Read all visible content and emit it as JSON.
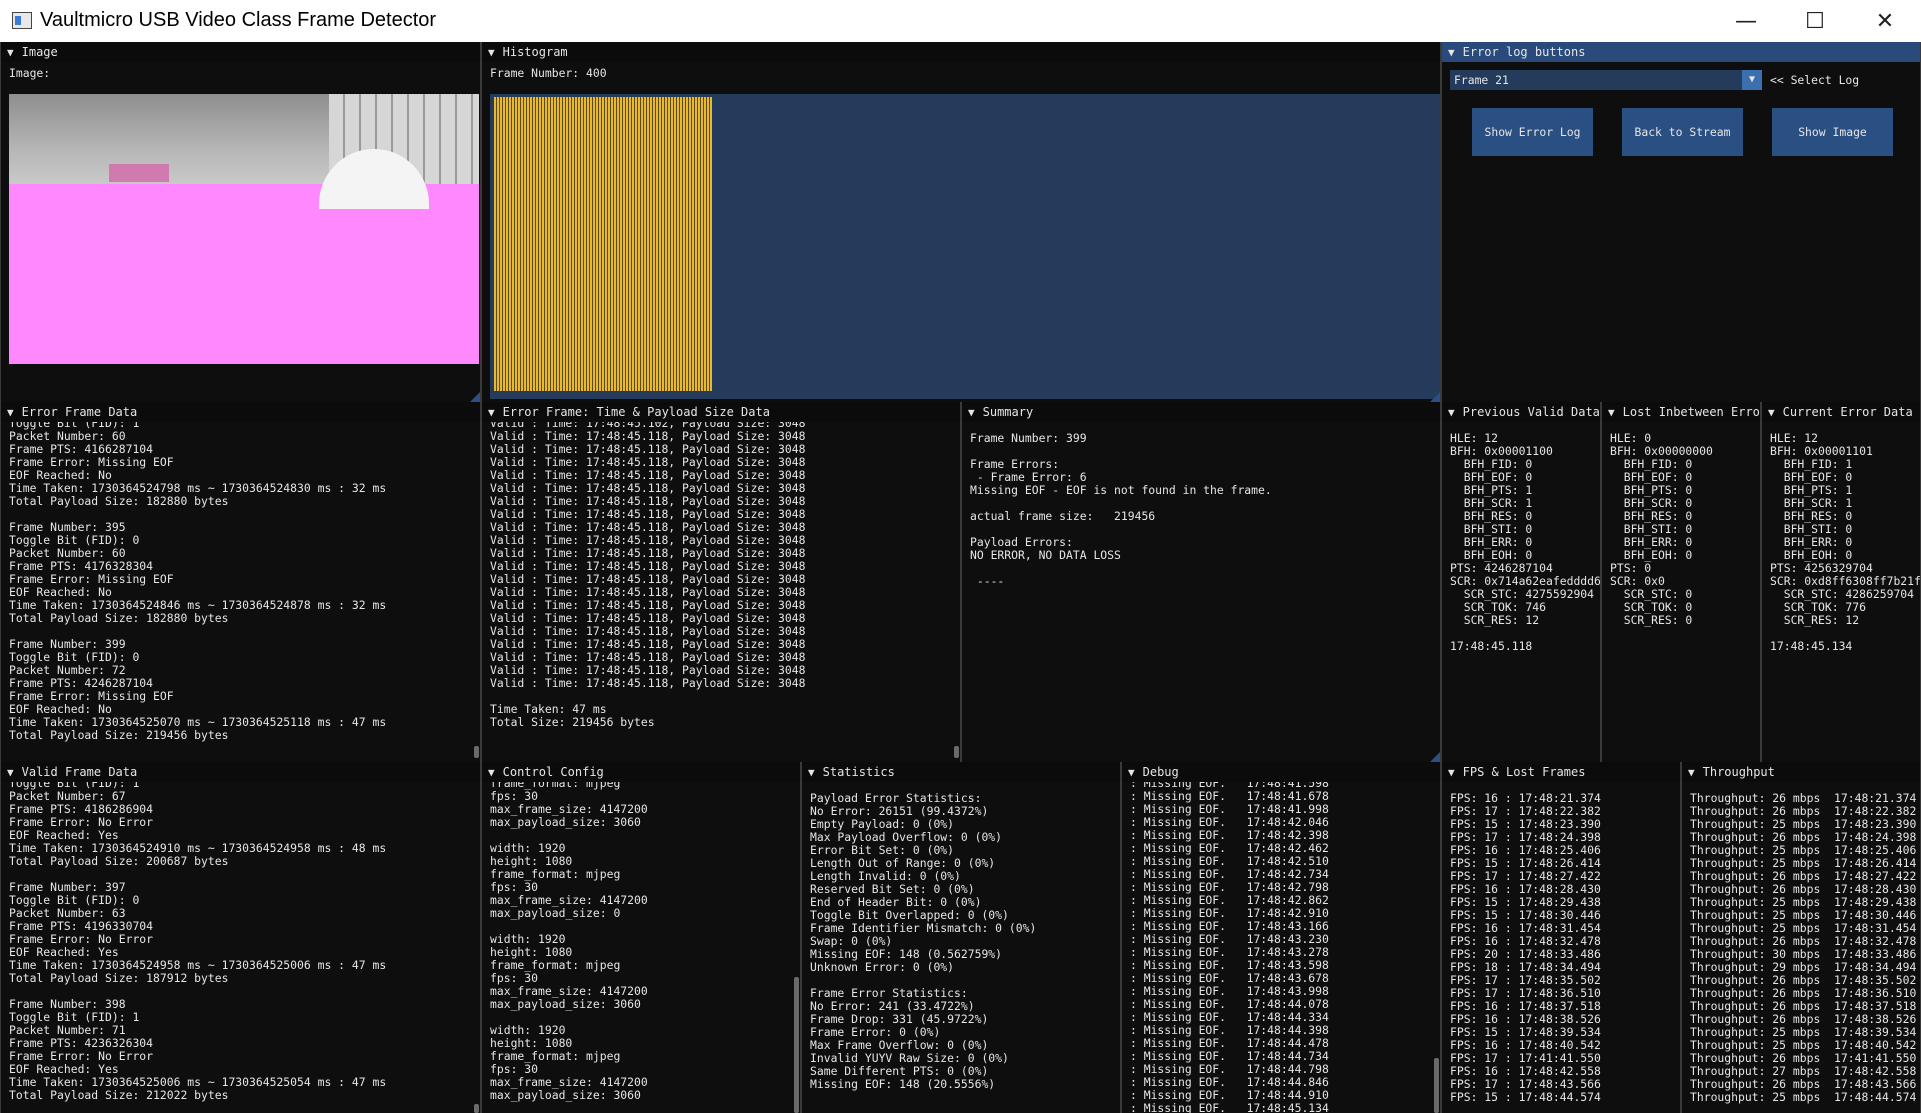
{
  "window": {
    "title": "Vaultmicro USB Video Class Frame Detector",
    "minimize": "—",
    "maximize": "☐",
    "close": "✕"
  },
  "image_panel": {
    "title": "Image",
    "label": "Image:"
  },
  "histogram": {
    "title": "Histogram",
    "frame_number": "Frame Number: 400"
  },
  "error_log": {
    "title": "Error log buttons",
    "selected": "Frame 21",
    "select_label": "<< Select Log",
    "buttons": [
      "Show Error Log",
      "Back to Stream",
      "Show Image"
    ]
  },
  "error_frame_data": {
    "title": "Error Frame Data",
    "text": "Toggle Bit (FID): 1\nPacket Number: 60\nFrame PTS: 4166287104\nFrame Error: Missing EOF\nEOF Reached: No\nTime Taken: 1730364524798 ms ~ 1730364524830 ms : 32 ms\nTotal Payload Size: 182880 bytes\n\nFrame Number: 395\nToggle Bit (FID): 0\nPacket Number: 60\nFrame PTS: 4176328304\nFrame Error: Missing EOF\nEOF Reached: No\nTime Taken: 1730364524846 ms ~ 1730364524878 ms : 32 ms\nTotal Payload Size: 182880 bytes\n\nFrame Number: 399\nToggle Bit (FID): 0\nPacket Number: 72\nFrame PTS: 4246287104\nFrame Error: Missing EOF\nEOF Reached: No\nTime Taken: 1730364525070 ms ~ 1730364525118 ms : 47 ms\nTotal Payload Size: 219456 bytes"
  },
  "error_time_payload": {
    "title": "Error Frame: Time & Payload Size Data",
    "text": "Valid : Time: 17:48:45.102, Payload Size: 3048\nValid : Time: 17:48:45.118, Payload Size: 3048\nValid : Time: 17:48:45.118, Payload Size: 3048\nValid : Time: 17:48:45.118, Payload Size: 3048\nValid : Time: 17:48:45.118, Payload Size: 3048\nValid : Time: 17:48:45.118, Payload Size: 3048\nValid : Time: 17:48:45.118, Payload Size: 3048\nValid : Time: 17:48:45.118, Payload Size: 3048\nValid : Time: 17:48:45.118, Payload Size: 3048\nValid : Time: 17:48:45.118, Payload Size: 3048\nValid : Time: 17:48:45.118, Payload Size: 3048\nValid : Time: 17:48:45.118, Payload Size: 3048\nValid : Time: 17:48:45.118, Payload Size: 3048\nValid : Time: 17:48:45.118, Payload Size: 3048\nValid : Time: 17:48:45.118, Payload Size: 3048\nValid : Time: 17:48:45.118, Payload Size: 3048\nValid : Time: 17:48:45.118, Payload Size: 3048\nValid : Time: 17:48:45.118, Payload Size: 3048\nValid : Time: 17:48:45.118, Payload Size: 3048\nValid : Time: 17:48:45.118, Payload Size: 3048\nValid : Time: 17:48:45.118, Payload Size: 3048\n\nTime Taken: 47 ms\nTotal Size: 219456 bytes"
  },
  "summary": {
    "title": "Summary",
    "text": "Frame Number: 399\n\nFrame Errors:\n - Frame Error: 6\nMissing EOF - EOF is not found in the frame.\n\nactual frame size:   219456\n\nPayload Errors:\nNO ERROR, NO DATA LOSS\n\n ----"
  },
  "previous_valid": {
    "title": "Previous Valid Data",
    "text": "HLE: 12\nBFH: 0x00001100\n  BFH_FID: 0\n  BFH_EOF: 0\n  BFH_PTS: 1\n  BFH_SCR: 1\n  BFH_RES: 0\n  BFH_STI: 0\n  BFH_ERR: 0\n  BFH_EOH: 0\nPTS: 4246287104\nSCR: 0x714a62eafedddd6\n  SCR_STC: 4275592904\n  SCR_TOK: 746\n  SCR_RES: 12\n\n17:48:45.118"
  },
  "lost_between": {
    "title": "Lost Inbetween Erro",
    "text": "HLE: 0\nBFH: 0x00000000\n  BFH_FID: 0\n  BFH_EOF: 0\n  BFH_PTS: 0\n  BFH_SCR: 0\n  BFH_RES: 0\n  BFH_STI: 0\n  BFH_ERR: 0\n  BFH_EOH: 0\nPTS: 0\nSCR: 0x0\n  SCR_STC: 0\n  SCR_TOK: 0\n  SCR_RES: 0"
  },
  "current_error": {
    "title": "Current Error Data",
    "text": "HLE: 12\nBFH: 0x00001101\n  BFH_FID: 1\n  BFH_EOF: 0\n  BFH_PTS: 1\n  BFH_SCR: 1\n  BFH_RES: 0\n  BFH_STI: 0\n  BFH_ERR: 0\n  BFH_EOH: 0\nPTS: 4256329704\nSCR: 0xd8ff6308ff7b21f\n  SCR_STC: 4286259704\n  SCR_TOK: 776\n  SCR_RES: 12\n\n17:48:45.134"
  },
  "valid_frame_data": {
    "title": "Valid Frame Data",
    "text": "Toggle Bit (FID): 1\nPacket Number: 67\nFrame PTS: 4186286904\nFrame Error: No Error\nEOF Reached: Yes\nTime Taken: 1730364524910 ms ~ 1730364524958 ms : 48 ms\nTotal Payload Size: 200687 bytes\n\nFrame Number: 397\nToggle Bit (FID): 0\nPacket Number: 63\nFrame PTS: 4196330704\nFrame Error: No Error\nEOF Reached: Yes\nTime Taken: 1730364524958 ms ~ 1730364525006 ms : 47 ms\nTotal Payload Size: 187912 bytes\n\nFrame Number: 398\nToggle Bit (FID): 1\nPacket Number: 71\nFrame PTS: 4236326304\nFrame Error: No Error\nEOF Reached: Yes\nTime Taken: 1730364525006 ms ~ 1730364525054 ms : 47 ms\nTotal Payload Size: 212022 bytes"
  },
  "control_config": {
    "title": "Control Config",
    "text": "frame_format: mjpeg\nfps: 30\nmax_frame_size: 4147200\nmax_payload_size: 3060\n\nwidth: 1920\nheight: 1080\nframe_format: mjpeg\nfps: 30\nmax_frame_size: 4147200\nmax_payload_size: 0\n\nwidth: 1920\nheight: 1080\nframe_format: mjpeg\nfps: 30\nmax_frame_size: 4147200\nmax_payload_size: 3060\n\nwidth: 1920\nheight: 1080\nframe_format: mjpeg\nfps: 30\nmax_frame_size: 4147200\nmax_payload_size: 3060"
  },
  "statistics": {
    "title": "Statistics",
    "text": "Payload Error Statistics:\nNo Error: 26151 (99.4372%)\nEmpty Payload: 0 (0%)\nMax Payload Overflow: 0 (0%)\nError Bit Set: 0 (0%)\nLength Out of Range: 0 (0%)\nLength Invalid: 0 (0%)\nReserved Bit Set: 0 (0%)\nEnd of Header Bit: 0 (0%)\nToggle Bit Overlapped: 0 (0%)\nFrame Identifier Mismatch: 0 (0%)\nSwap: 0 (0%)\nMissing EOF: 148 (0.562759%)\nUnknown Error: 0 (0%)\n\nFrame Error Statistics:\nNo Error: 241 (33.4722%)\nFrame Drop: 331 (45.9722%)\nFrame Error: 0 (0%)\nMax Frame Overflow: 0 (0%)\nInvalid YUYV Raw Size: 0 (0%)\nSame Different PTS: 0 (0%)\nMissing EOF: 148 (20.5556%)"
  },
  "debug": {
    "title": "Debug",
    "text": ": Missing EOF.   17:48:41.598\n: Missing EOF.   17:48:41.678\n: Missing EOF.   17:48:41.998\n: Missing EOF.   17:48:42.046\n: Missing EOF.   17:48:42.398\n: Missing EOF.   17:48:42.462\n: Missing EOF.   17:48:42.510\n: Missing EOF.   17:48:42.734\n: Missing EOF.   17:48:42.798\n: Missing EOF.   17:48:42.862\n: Missing EOF.   17:48:42.910\n: Missing EOF.   17:48:43.166\n: Missing EOF.   17:48:43.230\n: Missing EOF.   17:48:43.278\n: Missing EOF.   17:48:43.598\n: Missing EOF.   17:48:43.678\n: Missing EOF.   17:48:43.998\n: Missing EOF.   17:48:44.078\n: Missing EOF.   17:48:44.334\n: Missing EOF.   17:48:44.398\n: Missing EOF.   17:48:44.478\n: Missing EOF.   17:48:44.734\n: Missing EOF.   17:48:44.798\n: Missing EOF.   17:48:44.846\n: Missing EOF.   17:48:44.910\n: Missing EOF.   17:48:45.134"
  },
  "fps": {
    "title": "FPS & Lost Frames",
    "text": "FPS: 16 : 17:48:21.374\nFPS: 17 : 17:48:22.382\nFPS: 15 : 17:48:23.390\nFPS: 17 : 17:48:24.398\nFPS: 16 : 17:48:25.406\nFPS: 15 : 17:48:26.414\nFPS: 17 : 17:48:27.422\nFPS: 16 : 17:48:28.430\nFPS: 15 : 17:48:29.438\nFPS: 15 : 17:48:30.446\nFPS: 16 : 17:48:31.454\nFPS: 16 : 17:48:32.478\nFPS: 20 : 17:48:33.486\nFPS: 18 : 17:48:34.494\nFPS: 17 : 17:48:35.502\nFPS: 17 : 17:48:36.510\nFPS: 16 : 17:48:37.518\nFPS: 16 : 17:48:38.526\nFPS: 15 : 17:48:39.534\nFPS: 16 : 17:48:40.542\nFPS: 17 : 17:41:41.550\nFPS: 16 : 17:48:42.558\nFPS: 17 : 17:48:43.566\nFPS: 15 : 17:48:44.574"
  },
  "throughput": {
    "title": "Throughput",
    "text": "Throughput: 26 mbps  17:48:21.374\nThroughput: 26 mbps  17:48:22.382\nThroughput: 25 mbps  17:48:23.390\nThroughput: 26 mbps  17:48:24.398\nThroughput: 25 mbps  17:48:25.406\nThroughput: 25 mbps  17:48:26.414\nThroughput: 26 mbps  17:48:27.422\nThroughput: 26 mbps  17:48:28.430\nThroughput: 25 mbps  17:48:29.438\nThroughput: 25 mbps  17:48:30.446\nThroughput: 25 mbps  17:48:31.454\nThroughput: 26 mbps  17:48:32.478\nThroughput: 30 mbps  17:48:33.486\nThroughput: 29 mbps  17:48:34.494\nThroughput: 26 mbps  17:48:35.502\nThroughput: 26 mbps  17:48:36.510\nThroughput: 26 mbps  17:48:37.518\nThroughput: 26 mbps  17:48:38.526\nThroughput: 25 mbps  17:48:39.534\nThroughput: 25 mbps  17:48:40.542\nThroughput: 26 mbps  17:41:41.550\nThroughput: 27 mbps  17:48:42.558\nThroughput: 26 mbps  17:48:43.566\nThroughput: 25 mbps  17:48:44.574"
  }
}
